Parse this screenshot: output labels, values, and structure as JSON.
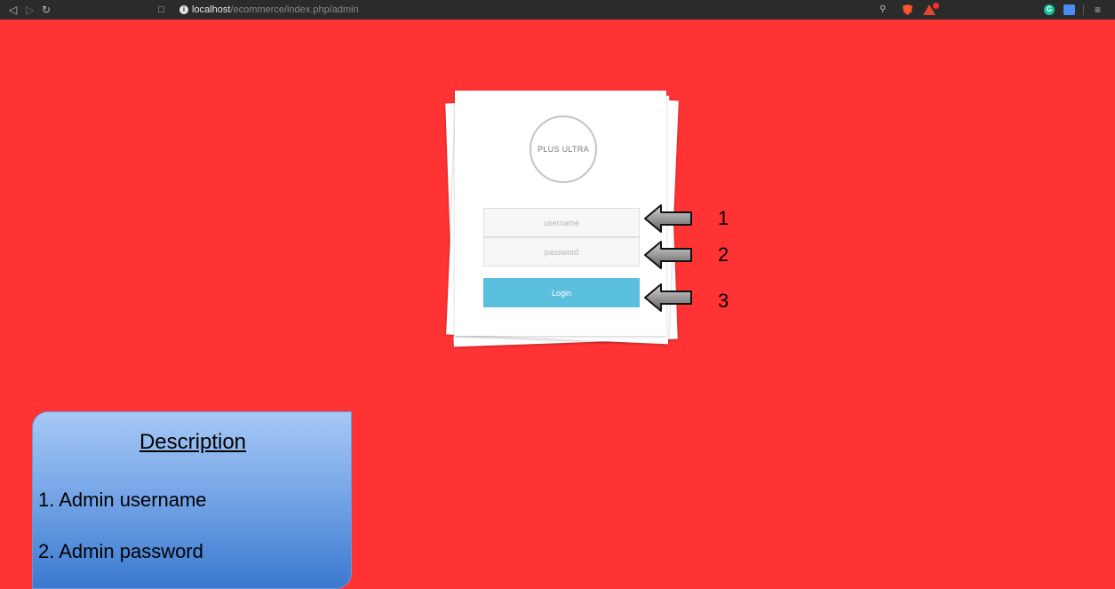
{
  "browser": {
    "url_host": "localhost",
    "url_path": "/ecommerce/index.php/admin",
    "nav_icons": [
      "back-icon",
      "forward-icon",
      "reload-icon",
      "bookmark-icon"
    ],
    "extension_icons": [
      "key-icon",
      "brave-shield-icon",
      "brave-rewards-icon",
      "grammarly-icon",
      "translate-icon",
      "menu-icon"
    ]
  },
  "login": {
    "logo_text": "PLUS ULTRA",
    "username_placeholder": "username",
    "password_placeholder": "password",
    "login_label": "Login"
  },
  "annotations": {
    "markers": [
      "1",
      "2",
      "3"
    ]
  },
  "description": {
    "title": "Description",
    "items": [
      "1. Admin username",
      "2. Admin password"
    ]
  },
  "colors": {
    "page_background": "#ff3333",
    "login_button": "#5bc0de",
    "description_gradient_top": "#a6c8f5",
    "description_gradient_bottom": "#3a79cf"
  }
}
